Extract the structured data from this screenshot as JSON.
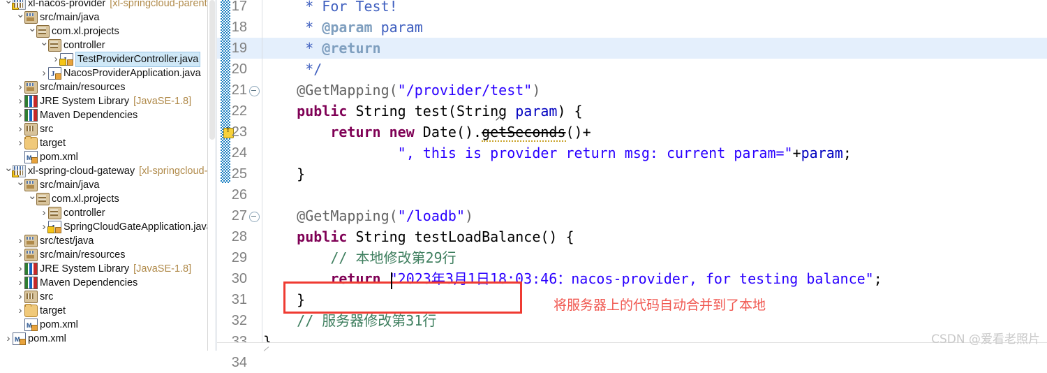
{
  "explorer": {
    "name": "package-explorer",
    "rows": [
      {
        "indent": 0,
        "arrow": "down",
        "icon": "project-icon",
        "label": "xl-nacos-provider",
        "meta": "[xl-springcloud-parent-pom",
        "selected": false
      },
      {
        "indent": 1,
        "arrow": "down",
        "icon": "package-root-icon",
        "label": "src/main/java",
        "meta": "",
        "selected": false
      },
      {
        "indent": 2,
        "arrow": "down",
        "icon": "package-icon",
        "label": "com.xl.projects",
        "meta": "",
        "selected": false
      },
      {
        "indent": 3,
        "arrow": "down",
        "icon": "package-icon",
        "label": "controller",
        "meta": "",
        "selected": false
      },
      {
        "indent": 4,
        "arrow": "right",
        "icon": "java-file-warn-icon",
        "label": "TestProviderController.java",
        "meta": "",
        "selected": true
      },
      {
        "indent": 3,
        "arrow": "right",
        "icon": "java-file-icon",
        "label": "NacosProviderApplication.java",
        "meta": "",
        "selected": false
      },
      {
        "indent": 1,
        "arrow": "right",
        "icon": "package-root-icon",
        "label": "src/main/resources",
        "meta": "",
        "selected": false
      },
      {
        "indent": 1,
        "arrow": "right",
        "icon": "library-icon",
        "label": "JRE System Library",
        "meta": "[JavaSE-1.8]",
        "selected": false
      },
      {
        "indent": 1,
        "arrow": "right",
        "icon": "library-icon",
        "label": "Maven Dependencies",
        "meta": "",
        "selected": false
      },
      {
        "indent": 1,
        "arrow": "right",
        "icon": "source-folder-icon",
        "label": "src",
        "meta": "",
        "selected": false
      },
      {
        "indent": 1,
        "arrow": "right",
        "icon": "folder-icon",
        "label": "target",
        "meta": "",
        "selected": false
      },
      {
        "indent": 1,
        "arrow": "none",
        "icon": "xml-file-icon",
        "label": "pom.xml",
        "meta": "",
        "selected": false
      },
      {
        "indent": 0,
        "arrow": "down",
        "icon": "project-icon",
        "label": "xl-spring-cloud-gateway",
        "meta": "[xl-springcloud-paren",
        "selected": false
      },
      {
        "indent": 1,
        "arrow": "down",
        "icon": "package-root-icon",
        "label": "src/main/java",
        "meta": "",
        "selected": false
      },
      {
        "indent": 2,
        "arrow": "down",
        "icon": "package-icon",
        "label": "com.xl.projects",
        "meta": "",
        "selected": false
      },
      {
        "indent": 3,
        "arrow": "right",
        "icon": "package-icon",
        "label": "controller",
        "meta": "",
        "selected": false
      },
      {
        "indent": 3,
        "arrow": "right",
        "icon": "java-file-warn-icon",
        "label": "SpringCloudGateApplication.java",
        "meta": "",
        "selected": false
      },
      {
        "indent": 1,
        "arrow": "right",
        "icon": "package-root-icon",
        "label": "src/test/java",
        "meta": "",
        "selected": false
      },
      {
        "indent": 1,
        "arrow": "right",
        "icon": "package-root-icon",
        "label": "src/main/resources",
        "meta": "",
        "selected": false
      },
      {
        "indent": 1,
        "arrow": "right",
        "icon": "library-icon",
        "label": "JRE System Library",
        "meta": "[JavaSE-1.8]",
        "selected": false
      },
      {
        "indent": 1,
        "arrow": "right",
        "icon": "library-icon",
        "label": "Maven Dependencies",
        "meta": "",
        "selected": false
      },
      {
        "indent": 1,
        "arrow": "right",
        "icon": "source-folder-icon",
        "label": "src",
        "meta": "",
        "selected": false
      },
      {
        "indent": 1,
        "arrow": "right",
        "icon": "folder-icon",
        "label": "target",
        "meta": "",
        "selected": false
      },
      {
        "indent": 1,
        "arrow": "none",
        "icon": "xml-file-icon",
        "label": "pom.xml",
        "meta": "",
        "selected": false
      },
      {
        "indent": 0,
        "arrow": "right",
        "icon": "xml-file-icon",
        "label": "pom.xml",
        "meta": "",
        "selected": false
      }
    ]
  },
  "editor": {
    "name": "java-source-editor",
    "first_line": 17,
    "highlighted_line": 19,
    "warning_line": 23,
    "fold_lines": [
      21,
      27
    ],
    "change_chunk_lines": [
      17,
      25
    ],
    "lines": [
      {
        "no": 17,
        "segments": [
          {
            "cls": "jdoc",
            "t": "     * For Test!"
          }
        ]
      },
      {
        "no": 18,
        "segments": [
          {
            "cls": "jdoc",
            "t": "     * "
          },
          {
            "cls": "jdoctag",
            "t": "@param"
          },
          {
            "cls": "jdoc",
            "t": " param"
          }
        ]
      },
      {
        "no": 19,
        "segments": [
          {
            "cls": "jdoc",
            "t": "     * "
          },
          {
            "cls": "jdoctag",
            "t": "@return"
          }
        ]
      },
      {
        "no": 20,
        "segments": [
          {
            "cls": "jdoc",
            "t": "     */"
          }
        ]
      },
      {
        "no": 21,
        "segments": [
          {
            "cls": "ann",
            "t": "    @GetMapping("
          },
          {
            "cls": "str",
            "t": "\"/provider/test\""
          },
          {
            "cls": "ann",
            "t": ")"
          }
        ]
      },
      {
        "no": 22,
        "segments": [
          {
            "cls": "kw",
            "t": "    public"
          },
          {
            "cls": "",
            "t": " String test(String "
          },
          {
            "cls": "fld",
            "t": "param"
          },
          {
            "cls": "",
            "t": ") {"
          }
        ]
      },
      {
        "no": 23,
        "segments": [
          {
            "cls": "kw",
            "t": "        return"
          },
          {
            "cls": "",
            "t": " "
          },
          {
            "cls": "kw",
            "t": "new"
          },
          {
            "cls": "",
            "t": " Date()."
          },
          {
            "cls": "depr squig",
            "t": "getSeconds"
          },
          {
            "cls": "",
            "t": "()+"
          }
        ]
      },
      {
        "no": 24,
        "segments": [
          {
            "cls": "str",
            "t": "                \", this is provider return msg: current param=\""
          },
          {
            "cls": "",
            "t": "+"
          },
          {
            "cls": "fld",
            "t": "param"
          },
          {
            "cls": "",
            "t": ";"
          }
        ]
      },
      {
        "no": 25,
        "segments": [
          {
            "cls": "",
            "t": "    }"
          }
        ]
      },
      {
        "no": 26,
        "segments": [
          {
            "cls": "",
            "t": ""
          }
        ]
      },
      {
        "no": 27,
        "segments": [
          {
            "cls": "ann",
            "t": "    @GetMapping("
          },
          {
            "cls": "str",
            "t": "\"/loadb\""
          },
          {
            "cls": "ann",
            "t": ")"
          }
        ]
      },
      {
        "no": 28,
        "segments": [
          {
            "cls": "kw",
            "t": "    public"
          },
          {
            "cls": "",
            "t": " String testLoadBalance() {"
          }
        ]
      },
      {
        "no": 29,
        "segments": [
          {
            "cls": "cmt",
            "t": "        // 本地修改第29行"
          }
        ]
      },
      {
        "no": 30,
        "segments": [
          {
            "cls": "kw",
            "t": "        return"
          },
          {
            "cls": "",
            "t": " "
          },
          {
            "cls": "str",
            "t": "\"2023年3月1日18:03:46：nacos-provider, for testing balance\""
          },
          {
            "cls": "",
            "t": ";"
          }
        ]
      },
      {
        "no": 31,
        "segments": [
          {
            "cls": "",
            "t": "    }"
          }
        ]
      },
      {
        "no": 32,
        "segments": [
          {
            "cls": "cmt",
            "t": "    // 服务器修改第31行"
          }
        ]
      },
      {
        "no": 33,
        "segments": [
          {
            "cls": "",
            "t": "}"
          }
        ]
      },
      {
        "no": 34,
        "segments": [
          {
            "cls": "",
            "t": ""
          }
        ]
      }
    ]
  },
  "annotations": {
    "red_box": {
      "name": "server-change-highlight-box",
      "color": "#ef3b32"
    },
    "red_note": {
      "text": "将服务器上的代码自动合并到了本地",
      "color": "#f0564f"
    }
  },
  "watermark": {
    "text": "CSDN @爱看老照片",
    "color": "#c9c9c9"
  }
}
